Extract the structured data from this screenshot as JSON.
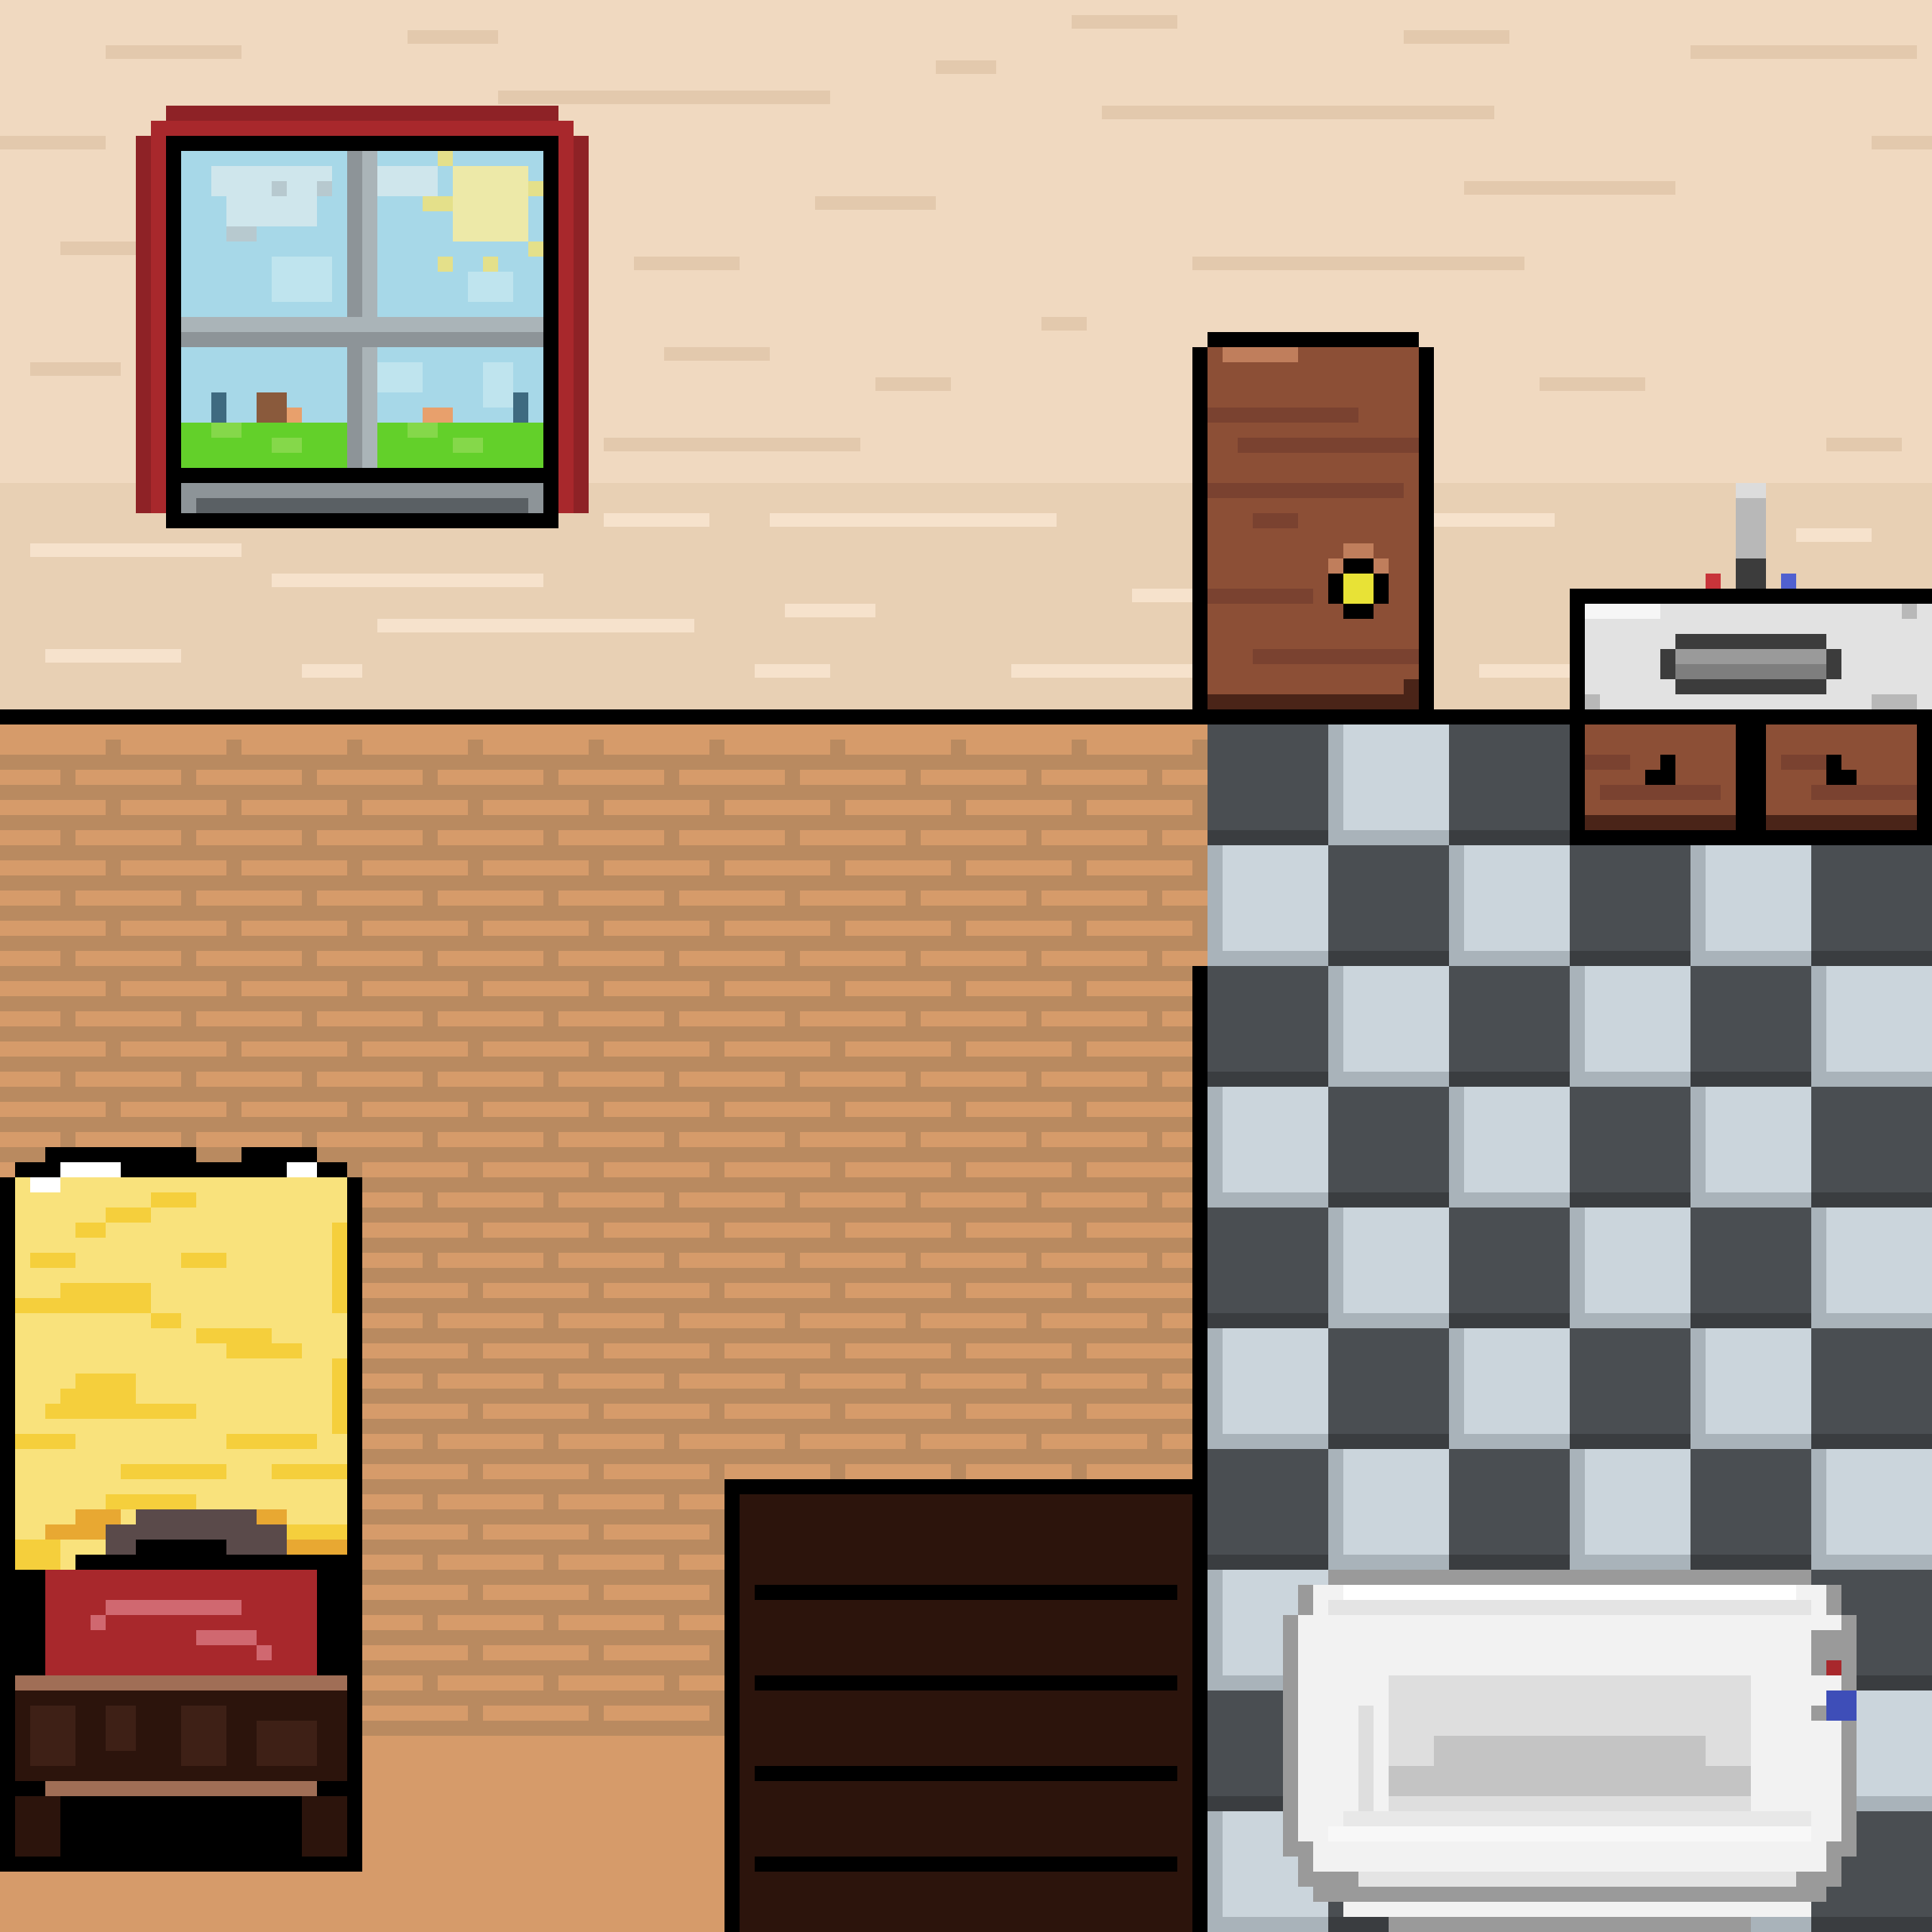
{
  "scene": {
    "room": "bedroom-bathroom",
    "style": "pixel-art",
    "objects": [
      {
        "name": "window",
        "icon": "window-icon"
      },
      {
        "name": "door",
        "icon": "door-icon"
      },
      {
        "name": "sink",
        "icon": "sink-icon"
      },
      {
        "name": "bed",
        "icon": "bed-icon"
      },
      {
        "name": "rug",
        "icon": "rug-icon"
      },
      {
        "name": "bathtub",
        "icon": "bathtub-icon"
      }
    ]
  },
  "colors": {
    "wall": "#f0d9c0",
    "wall_shadow": "#e6ceb4",
    "wood_floor": "#d69b6a",
    "wood_floor_dark": "#b98a60",
    "tile_light": "#cbd5dc",
    "tile_dark": "#4a4e52",
    "outline": "#000000",
    "curtain": "#a8282c",
    "sky": "#a7d8e8",
    "grass": "#63d02a",
    "door": "#8c4f36",
    "door_knob": "#e8e236",
    "blanket": "#f9e27c",
    "pillow_red": "#a8282c",
    "rug": "#2c140c",
    "tub": "#f2f2f2"
  }
}
